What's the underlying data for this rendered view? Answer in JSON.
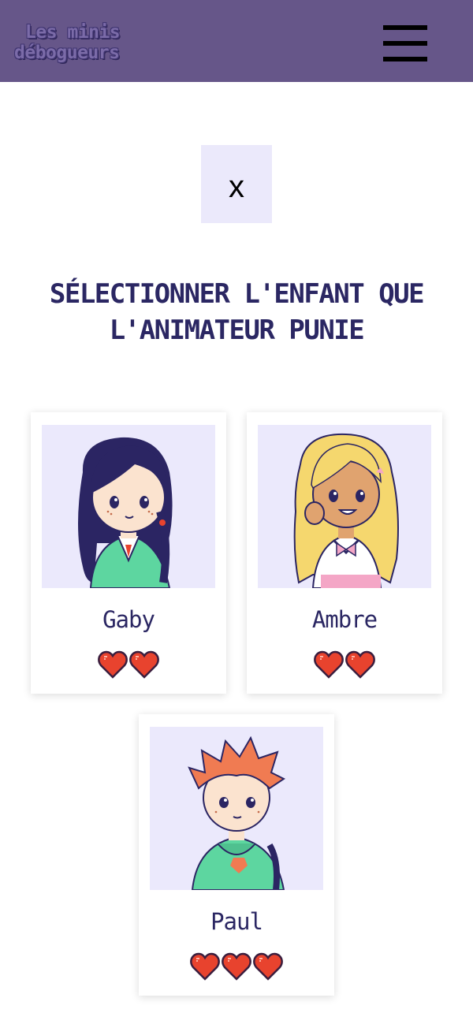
{
  "header": {
    "logo_line1": "Les minis",
    "logo_line2": "débogueurs",
    "menu_icon": "hamburger-icon"
  },
  "close_button": {
    "label": "x"
  },
  "title": "SÉLECTIONNER L'ENFANT QUE L'ANIMATEUR PUNIE",
  "children": [
    {
      "name": "Gaby",
      "hearts": 2,
      "hair_color": "#2b2563",
      "outfit_color": "#5dd6a0"
    },
    {
      "name": "Ambre",
      "hearts": 2,
      "hair_color": "#f5d76e",
      "outfit_color": "#f4a6c6"
    },
    {
      "name": "Paul",
      "hearts": 3,
      "hair_color": "#f07b52",
      "outfit_color": "#5dd6a0"
    }
  ],
  "colors": {
    "header_bg": "#665689",
    "title_text": "#2b2763",
    "portrait_bg": "#ebe9fc",
    "heart": "#e8432e"
  }
}
